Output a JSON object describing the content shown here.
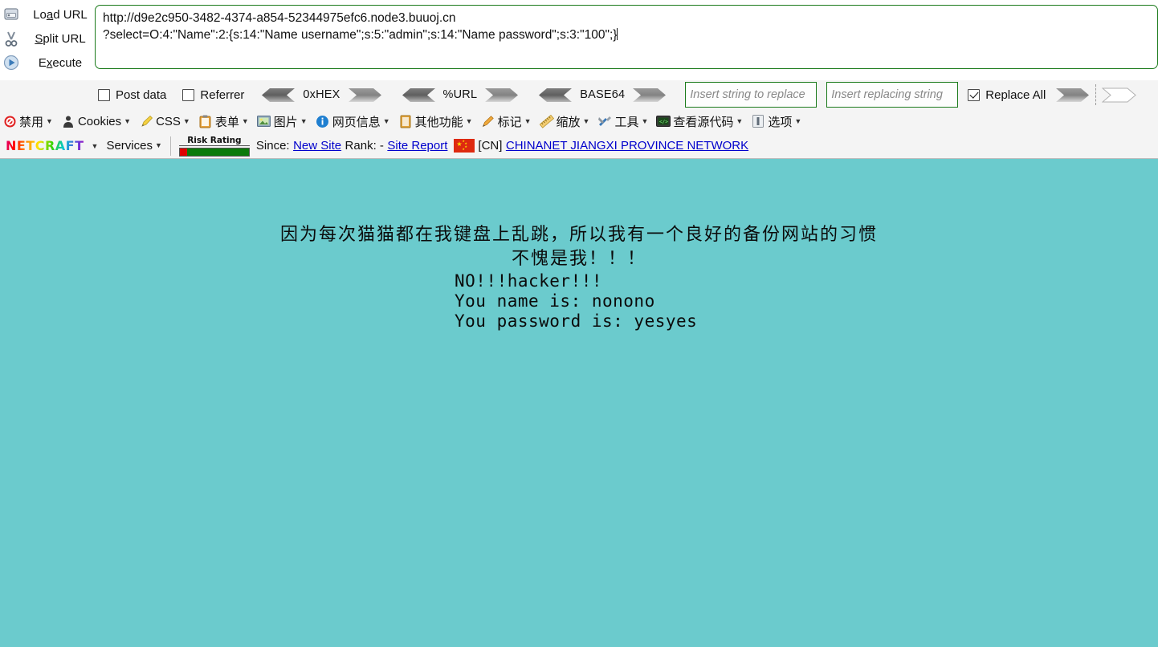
{
  "url_actions": [
    {
      "icon": "load-url-icon",
      "label_pre": "Lo",
      "label_key": "a",
      "label_post": "d URL",
      "full": "Load URL"
    },
    {
      "icon": "split-url-scissors-icon",
      "label_pre": "",
      "label_key": "S",
      "label_post": "plit URL",
      "full": "Split URL"
    },
    {
      "icon": "execute-play-icon",
      "label_pre": "E",
      "label_key": "x",
      "label_post": "ecute",
      "full": "Execute"
    }
  ],
  "url_field": {
    "line1": "http://d9e2c950-3482-4374-a854-52344975efc6.node3.buuoj.cn",
    "line2": "?select=O:4:\"Name\":2:{s:14:\"Name username\";s:5:\"admin\";s:14:\"Name password\";s:3:\"100\";}"
  },
  "options_row": {
    "post_data": {
      "label": "Post data",
      "checked": false
    },
    "referrer": {
      "label": "Referrer",
      "checked": false
    },
    "converters": [
      {
        "name": "0xHEX"
      },
      {
        "name": "%URL"
      },
      {
        "name": "BASE64"
      }
    ],
    "replace_find_placeholder": "Insert string to replace",
    "replace_with_placeholder": "Insert replacing string",
    "replace_all": {
      "label": "Replace All",
      "checked": true
    }
  },
  "webdev_toolbar": [
    {
      "icon": "disable-icon",
      "label": "禁用"
    },
    {
      "icon": "cookies-icon",
      "label": "Cookies"
    },
    {
      "icon": "css-pencil-icon",
      "label": "CSS"
    },
    {
      "icon": "forms-clipboard-icon",
      "label": "表单"
    },
    {
      "icon": "images-icon",
      "label": "图片"
    },
    {
      "icon": "page-info-icon",
      "label": "网页信息"
    },
    {
      "icon": "misc-icon",
      "label": "其他功能"
    },
    {
      "icon": "outline-pencil-icon",
      "label": "标记"
    },
    {
      "icon": "resize-ruler-icon",
      "label": "缩放"
    },
    {
      "icon": "tools-icon",
      "label": "工具"
    },
    {
      "icon": "view-source-icon",
      "label": "查看源代码"
    },
    {
      "icon": "options-icon",
      "label": "选项"
    }
  ],
  "netcraft": {
    "logo_text": "NETCRAFT",
    "services_label": "Services",
    "risk_rating_label": "Risk Rating",
    "since_label": "Since:",
    "since_value": "New Site",
    "rank_label": "Rank: -",
    "site_report": "Site Report",
    "country_code": "[CN]",
    "network": "CHINANET JIANGXI PROVINCE NETWORK"
  },
  "page_content": {
    "bg_color": "#6bcbcd",
    "line1": "因为每次猫猫都在我键盘上乱跳，所以我有一个良好的备份网站的习惯",
    "line2": "不愧是我！！！",
    "mono1": "NO!!!hacker!!!",
    "mono2": "You name is: nonono",
    "mono3": "You password is: yesyes"
  }
}
